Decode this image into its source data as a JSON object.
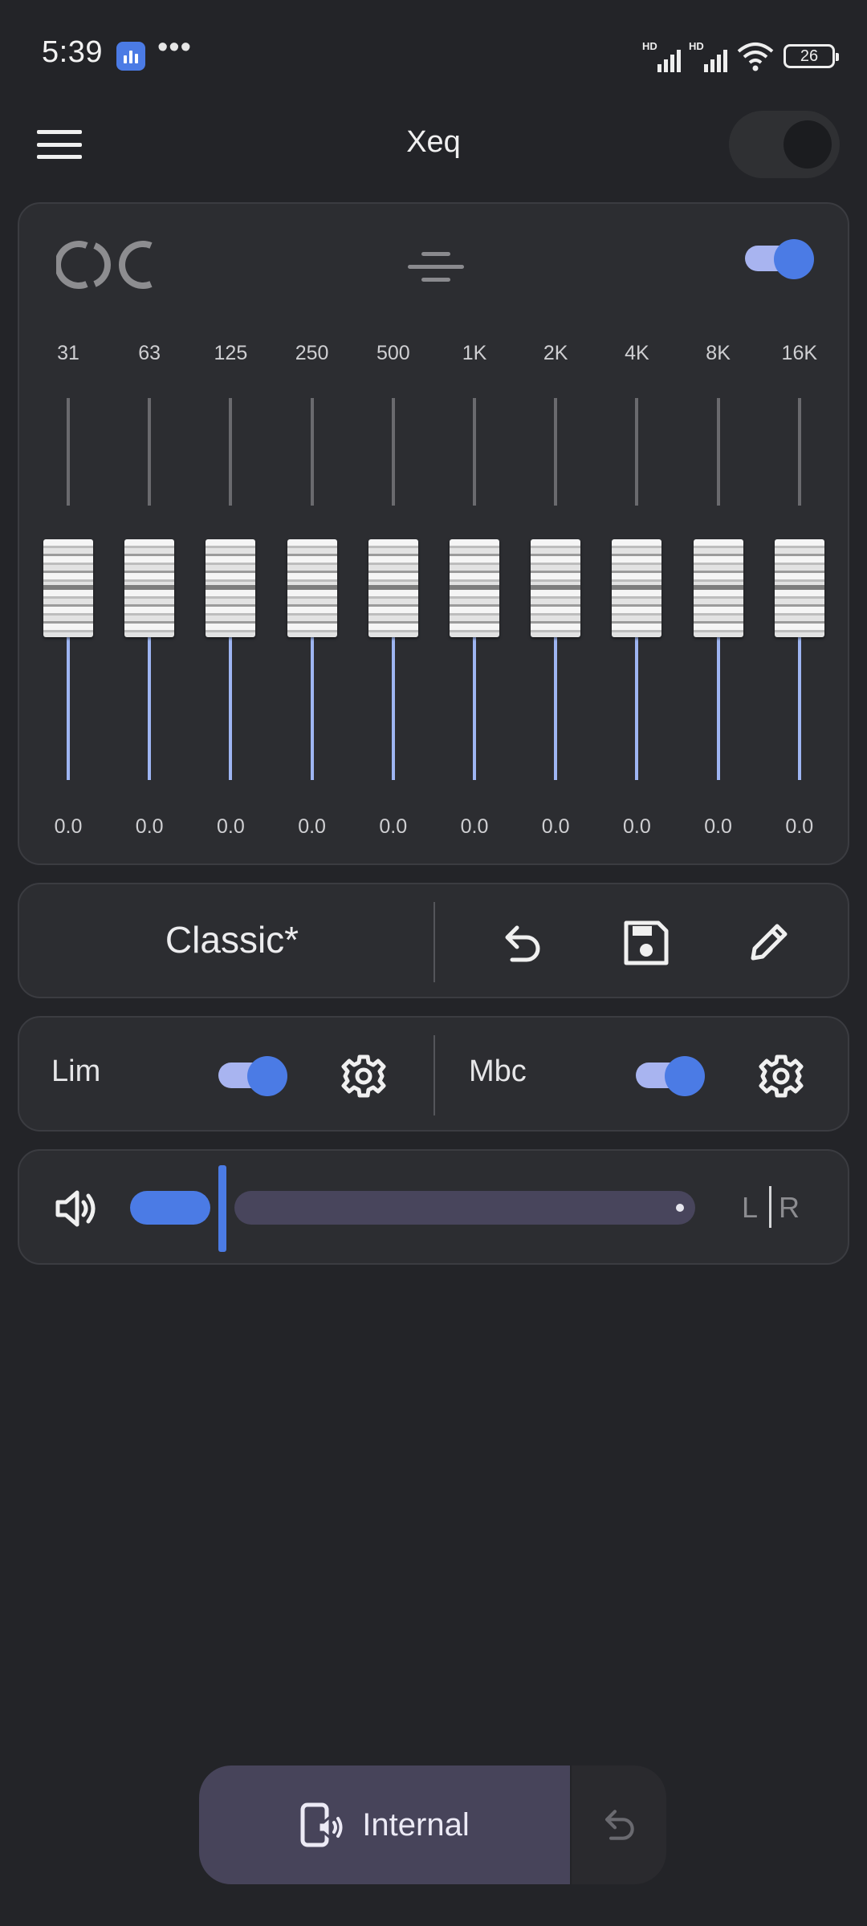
{
  "status_bar": {
    "time": "5:39",
    "overflow": "•••",
    "signal_label": "HD",
    "battery": "26"
  },
  "app_bar": {
    "title": "Xeq",
    "menu_icon": "hamburger-menu-icon",
    "master_toggle_on": false
  },
  "equalizer": {
    "enabled": true,
    "bands": [
      {
        "label": "31",
        "value": "0.0"
      },
      {
        "label": "63",
        "value": "0.0"
      },
      {
        "label": "125",
        "value": "0.0"
      },
      {
        "label": "250",
        "value": "0.0"
      },
      {
        "label": "500",
        "value": "0.0"
      },
      {
        "label": "1K",
        "value": "0.0"
      },
      {
        "label": "2K",
        "value": "0.0"
      },
      {
        "label": "4K",
        "value": "0.0"
      },
      {
        "label": "8K",
        "value": "0.0"
      },
      {
        "label": "16K",
        "value": "0.0"
      }
    ]
  },
  "preset": {
    "name": "Classic*",
    "actions": [
      "undo-icon",
      "save-icon",
      "edit-icon"
    ]
  },
  "dsp": {
    "limiter": {
      "label": "Lim",
      "enabled": true
    },
    "mbc": {
      "label": "Mbc",
      "enabled": true
    }
  },
  "volume": {
    "level": 0.16,
    "balance_left": "L",
    "balance_right": "R"
  },
  "output": {
    "label": "Internal"
  },
  "colors": {
    "accent": "#4b7be5",
    "background": "#232428",
    "card": "#2c2d31",
    "pill": "#47445a"
  }
}
